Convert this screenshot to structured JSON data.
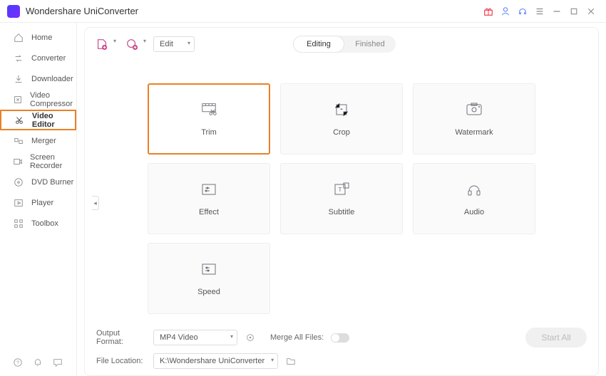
{
  "app_title": "Wondershare UniConverter",
  "sidebar": {
    "items": [
      {
        "label": "Home"
      },
      {
        "label": "Converter"
      },
      {
        "label": "Downloader"
      },
      {
        "label": "Video Compressor"
      },
      {
        "label": "Video Editor"
      },
      {
        "label": "Merger"
      },
      {
        "label": "Screen Recorder"
      },
      {
        "label": "DVD Burner"
      },
      {
        "label": "Player"
      },
      {
        "label": "Toolbox"
      }
    ]
  },
  "toolbar": {
    "edit_label": "Edit",
    "segment_editing": "Editing",
    "segment_finished": "Finished"
  },
  "cards": {
    "trim": "Trim",
    "crop": "Crop",
    "watermark": "Watermark",
    "effect": "Effect",
    "subtitle": "Subtitle",
    "audio": "Audio",
    "speed": "Speed"
  },
  "footer": {
    "output_format_label": "Output Format:",
    "output_format_value": "MP4 Video",
    "merge_label": "Merge All Files:",
    "file_location_label": "File Location:",
    "file_location_value": "K:\\Wondershare UniConverter",
    "start_all": "Start All"
  }
}
